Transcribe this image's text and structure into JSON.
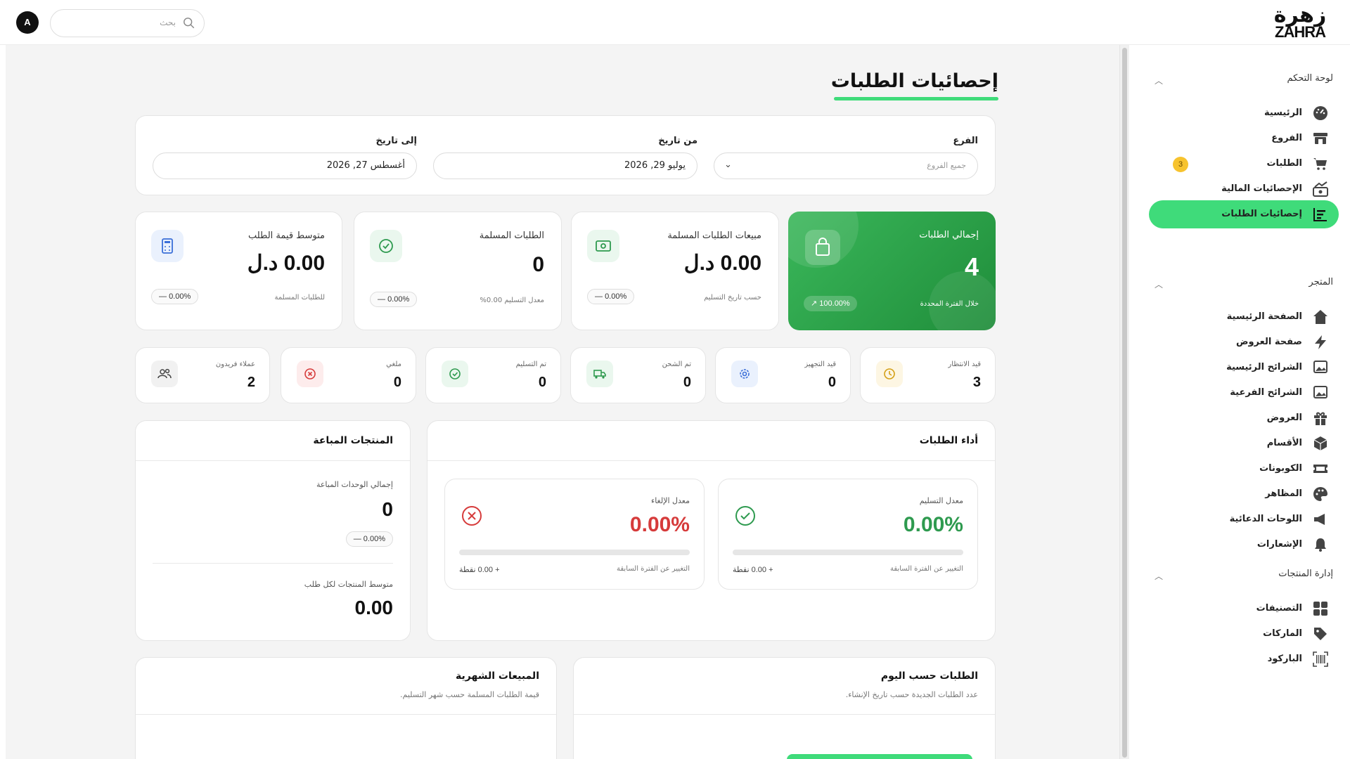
{
  "header": {
    "logo_ar": "زهرة",
    "logo_en": "ZAHRA",
    "search_placeholder": "بحث",
    "avatar_initial": "A"
  },
  "sidebar": {
    "sections": [
      {
        "title": "لوحة التحكم",
        "items": [
          {
            "label": "الرئيسية",
            "icon": "dashboard-icon"
          },
          {
            "label": "الفروع",
            "icon": "store-icon"
          },
          {
            "label": "الطلبات",
            "icon": "cart-icon",
            "badge": "3"
          },
          {
            "label": "الإحصائيات المالية",
            "icon": "chart-up-icon"
          },
          {
            "label": "إحصائيات الطلبات",
            "icon": "orders-stats-icon",
            "active": true
          }
        ]
      },
      {
        "title": "المتجر",
        "items": [
          {
            "label": "الصفحة الرئيسية",
            "icon": "home-icon"
          },
          {
            "label": "صفحة العروض",
            "icon": "bolt-icon"
          },
          {
            "label": "الشرائح الرئيسية",
            "icon": "image-icon"
          },
          {
            "label": "الشرائح الفرعية",
            "icon": "image-icon"
          },
          {
            "label": "العروض",
            "icon": "gift-icon"
          },
          {
            "label": "الأقسام",
            "icon": "box-icon"
          },
          {
            "label": "الكوبونات",
            "icon": "ticket-icon"
          },
          {
            "label": "المظاهر",
            "icon": "palette-icon"
          },
          {
            "label": "اللوحات الدعائية",
            "icon": "megaphone-icon"
          },
          {
            "label": "الإشعارات",
            "icon": "bell-icon"
          }
        ]
      },
      {
        "title": "إدارة المنتجات",
        "items": [
          {
            "label": "التصنيفات",
            "icon": "grid-icon"
          },
          {
            "label": "الماركات",
            "icon": "tag-icon"
          },
          {
            "label": "الباركود",
            "icon": "barcode-icon"
          }
        ]
      }
    ]
  },
  "page": {
    "title": "إحصائيات الطلبات",
    "filters": {
      "branch_label": "الفرع",
      "branch_placeholder": "جميع الفروع",
      "from_label": "من تاريخ",
      "from_value": "يوليو 29, 2026",
      "to_label": "إلى تاريخ",
      "to_value": "أغسطس 27, 2026"
    },
    "kpis": [
      {
        "title": "إجمالي الطلبات",
        "value": "4",
        "sub": "خلال الفترة المحددة",
        "pill": "100.00% ↗",
        "icon": "shopping-bag-icon"
      },
      {
        "title": "مبيعات الطلبات المسلمة",
        "value": "0.00 د.ل",
        "sub": "حسب تاريخ التسليم",
        "pill": "0.00% —",
        "icon": "money-icon"
      },
      {
        "title": "الطلبات المسلمة",
        "value": "0",
        "sub": "معدل التسليم 0.00%",
        "pill": "0.00% —",
        "icon": "check-circle-icon"
      },
      {
        "title": "متوسط قيمة الطلب",
        "value": "0.00 د.ل",
        "sub": "للطلبات المسلمة",
        "pill": "0.00% —",
        "icon": "calculator-icon"
      }
    ],
    "statuses": [
      {
        "label": "قيد الانتظار",
        "value": "3",
        "icon": "clock-icon",
        "color": "#d4a017",
        "bg": "#fdf6e3"
      },
      {
        "label": "قيد التجهيز",
        "value": "0",
        "icon": "gear-icon",
        "color": "#3b6fd8",
        "bg": "#eaf1fd"
      },
      {
        "label": "تم الشحن",
        "value": "0",
        "icon": "truck-icon",
        "color": "#2e9a4f",
        "bg": "#eaf7ee"
      },
      {
        "label": "تم التسليم",
        "value": "0",
        "icon": "check-circle-icon",
        "color": "#2e9a4f",
        "bg": "#eaf7ee"
      },
      {
        "label": "ملغي",
        "value": "0",
        "icon": "x-circle-icon",
        "color": "#d63b3b",
        "bg": "#fdecec"
      },
      {
        "label": "عملاء فريدون",
        "value": "2",
        "icon": "users-icon",
        "color": "#444444",
        "bg": "#f1f1f1"
      }
    ],
    "performance": {
      "title": "أداء الطلبات",
      "delivery": {
        "label": "معدل التسليم",
        "value": "0.00%",
        "change_label": "التغيير عن الفترة السابقة",
        "points": "+ 0.00 نقطة",
        "color": "#2e9a4f"
      },
      "cancel": {
        "label": "معدل الإلغاء",
        "value": "0.00%",
        "change_label": "التغيير عن الفترة السابقة",
        "points": "+ 0.00 نقطة",
        "color": "#d63b3b"
      }
    },
    "products": {
      "title": "المنتجات المباعة",
      "units_label": "إجمالي الوحدات المباعة",
      "units_value": "0",
      "units_pill": "0.00% —",
      "avg_label": "متوسط المنتجات لكل طلب",
      "avg_value": "0.00"
    },
    "daily": {
      "title": "الطلبات حسب اليوم",
      "subtitle": "عدد الطلبات الجديدة حسب تاريخ الإنشاء."
    },
    "monthly": {
      "title": "المبيعات الشهرية",
      "subtitle": "قيمة الطلبات المسلمة حسب شهر التسليم."
    }
  },
  "colors": {
    "accent": "#3fdb7a",
    "kpi_green": "#2a9f48"
  }
}
